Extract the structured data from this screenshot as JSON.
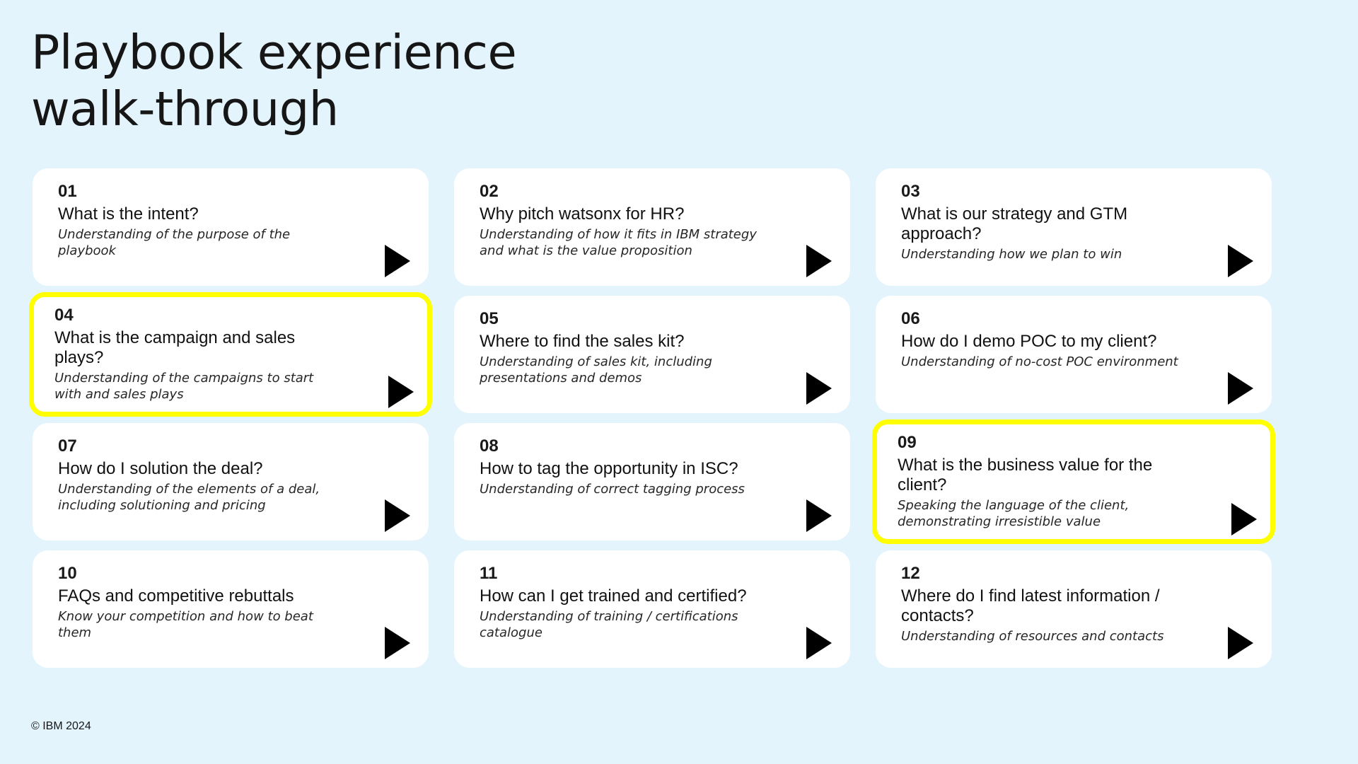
{
  "title": {
    "line1": "Playbook experience",
    "line2": "walk-through"
  },
  "cards": [
    {
      "number": "01",
      "question": "What is the intent?",
      "description": "Understanding of the purpose of the playbook",
      "highlighted": false
    },
    {
      "number": "02",
      "question": "Why pitch watsonx for HR?",
      "description": "Understanding of how it fits in IBM strategy and what is the value proposition",
      "highlighted": false
    },
    {
      "number": "03",
      "question": "What is our strategy and GTM approach?",
      "description": "Understanding how we plan to win",
      "highlighted": false
    },
    {
      "number": "04",
      "question": "What is the campaign and sales plays?",
      "description": "Understanding of the campaigns to start with and sales plays",
      "highlighted": true
    },
    {
      "number": "05",
      "question": "Where to find the sales kit?",
      "description": "Understanding of sales kit, including presentations and demos",
      "highlighted": false
    },
    {
      "number": "06",
      "question": "How do I demo POC to my client?",
      "description": "Understanding of no-cost POC environment",
      "highlighted": false
    },
    {
      "number": "07",
      "question": "How do I solution the deal?",
      "description": "Understanding of the elements of a deal, including solutioning and pricing",
      "highlighted": false
    },
    {
      "number": "08",
      "question": "How to tag the opportunity in ISC?",
      "description": "Understanding of correct tagging process",
      "highlighted": false
    },
    {
      "number": "09",
      "question": "What is the business value for the client?",
      "description": "Speaking the language of the client, demonstrating irresistible value",
      "highlighted": true
    },
    {
      "number": "10",
      "question": "FAQs and competitive rebuttals",
      "description": "Know your competition and how to beat them",
      "highlighted": false
    },
    {
      "number": "11",
      "question": "How can I get trained and certified?",
      "description": "Understanding of training / certifications catalogue",
      "highlighted": false
    },
    {
      "number": "12",
      "question": "Where do I find latest information / contacts?",
      "description": "Understanding of resources and contacts",
      "highlighted": false
    }
  ],
  "footer": "© IBM 2024",
  "colors": {
    "background": "#e3f4fd",
    "card": "#ffffff",
    "highlight": "#ffff00",
    "play_icon": "#000000"
  }
}
